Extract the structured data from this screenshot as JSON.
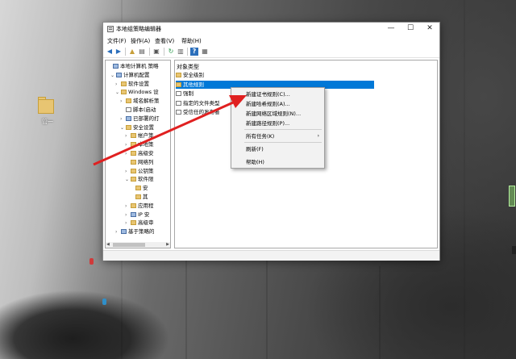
{
  "window": {
    "title": "本地组策略编辑器",
    "controls": {
      "minimize": "—",
      "maximize": "☐",
      "close": "✕"
    }
  },
  "menubar": [
    {
      "label": "文件(F)"
    },
    {
      "label": "操作(A)"
    },
    {
      "label": "查看(V)"
    },
    {
      "label": "帮助(H)"
    }
  ],
  "tree": [
    {
      "label": "本地计算机 策略",
      "expander": "",
      "icon": "pc"
    },
    {
      "label": "计算机配置",
      "expander": "⌄",
      "icon": "pc"
    },
    {
      "label": "软件设置",
      "expander": "›",
      "icon": "fld"
    },
    {
      "label": "Windows 设",
      "expander": "⌄",
      "icon": "fld"
    },
    {
      "label": "域名解析策",
      "expander": "›",
      "icon": "fld"
    },
    {
      "label": "脚本(启动",
      "expander": "",
      "icon": "cert"
    },
    {
      "label": "已部署的打",
      "expander": "›",
      "icon": "pc"
    },
    {
      "label": "安全设置",
      "expander": "⌄",
      "icon": "fld"
    },
    {
      "label": "帐户策",
      "expander": "›",
      "icon": "fld"
    },
    {
      "label": "本地策",
      "expander": "›",
      "icon": "fld"
    },
    {
      "label": "高级安",
      "expander": "›",
      "icon": "fld"
    },
    {
      "label": "网络列",
      "expander": "",
      "icon": "fld"
    },
    {
      "label": "公钥策",
      "expander": "›",
      "icon": "fld"
    },
    {
      "label": "软件限",
      "expander": "⌄",
      "icon": "fld"
    },
    {
      "label": "安",
      "expander": "",
      "icon": "fld"
    },
    {
      "label": "其",
      "expander": "",
      "icon": "fld"
    },
    {
      "label": "应用程",
      "expander": "›",
      "icon": "fld"
    },
    {
      "label": "IP 安",
      "expander": "›",
      "icon": "pc"
    },
    {
      "label": "高级审",
      "expander": "›",
      "icon": "fld"
    },
    {
      "label": "基于策略的",
      "expander": "›",
      "icon": "pc"
    }
  ],
  "list": {
    "header": "对象类型",
    "rows": [
      {
        "label": "安全级别",
        "icon": "fld",
        "selected": false
      },
      {
        "label": "其他规则",
        "icon": "fld",
        "selected": true
      },
      {
        "label": "强制",
        "icon": "cert",
        "selected": false
      },
      {
        "label": "指定的文件类型",
        "icon": "cert",
        "selected": false
      },
      {
        "label": "受信任的发布者",
        "icon": "cert",
        "selected": false
      }
    ]
  },
  "context_menu": {
    "items": [
      {
        "label": "新建证书规则(C)...",
        "submenu": false
      },
      {
        "label": "新建哈希规则(A)...",
        "submenu": false
      },
      {
        "label": "新建网络区域规则(N)...",
        "submenu": false
      },
      {
        "label": "新建路径规则(P)...",
        "submenu": false
      },
      {
        "label": "所有任务(K)",
        "submenu": true,
        "arrow": "›"
      },
      {
        "label": "刷新(F)",
        "submenu": false
      },
      {
        "label": "帮助(H)",
        "submenu": false
      }
    ]
  },
  "desktop": {
    "icon_label": "管一"
  },
  "colors": {
    "selection": "#0078d7",
    "annotation_arrow": "#e02020",
    "folder": "#e8c572"
  }
}
